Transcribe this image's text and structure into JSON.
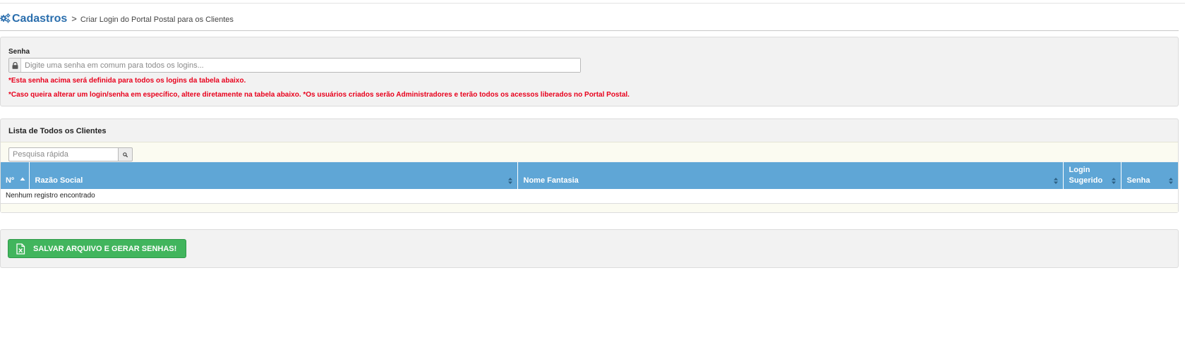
{
  "breadcrumb": {
    "section": "Cadastros",
    "separator": ">",
    "current": "Criar Login do Portal Postal para os Clientes"
  },
  "senha": {
    "label": "Senha",
    "placeholder": "Digite uma senha em comum para todos os logins...",
    "value": "",
    "note1": "*Esta senha acima será definida para todos os logins da tabela abaixo.",
    "note2": "*Caso queira alterar um login/senha em específico, altere diretamente na tabela abaixo. *Os usuários criados serão Administradores e terão todos os acessos liberados no Portal Postal."
  },
  "list": {
    "title": "Lista de Todos os Clientes",
    "search_placeholder": "Pesquisa rápida",
    "columns": [
      {
        "label": "Nº"
      },
      {
        "label": "Razão Social"
      },
      {
        "label": "Nome Fantasia"
      },
      {
        "label": "Login Sugerido"
      },
      {
        "label": "Senha"
      }
    ],
    "rows": [],
    "empty_message": "Nenhum registro encontrado"
  },
  "actions": {
    "save_label": "SALVAR ARQUIVO E GERAR SENHAS!"
  },
  "colors": {
    "brand_blue": "#2a6ead",
    "table_header": "#5fa6d6",
    "warning_red": "#e8001c",
    "button_green": "#41b55d"
  },
  "icons": {
    "section": "cogs-icon",
    "lock": "lock-icon",
    "search": "search-icon",
    "excel": "file-excel-icon",
    "sort_asc": "sort-asc-icon",
    "sort": "sort-icon"
  }
}
